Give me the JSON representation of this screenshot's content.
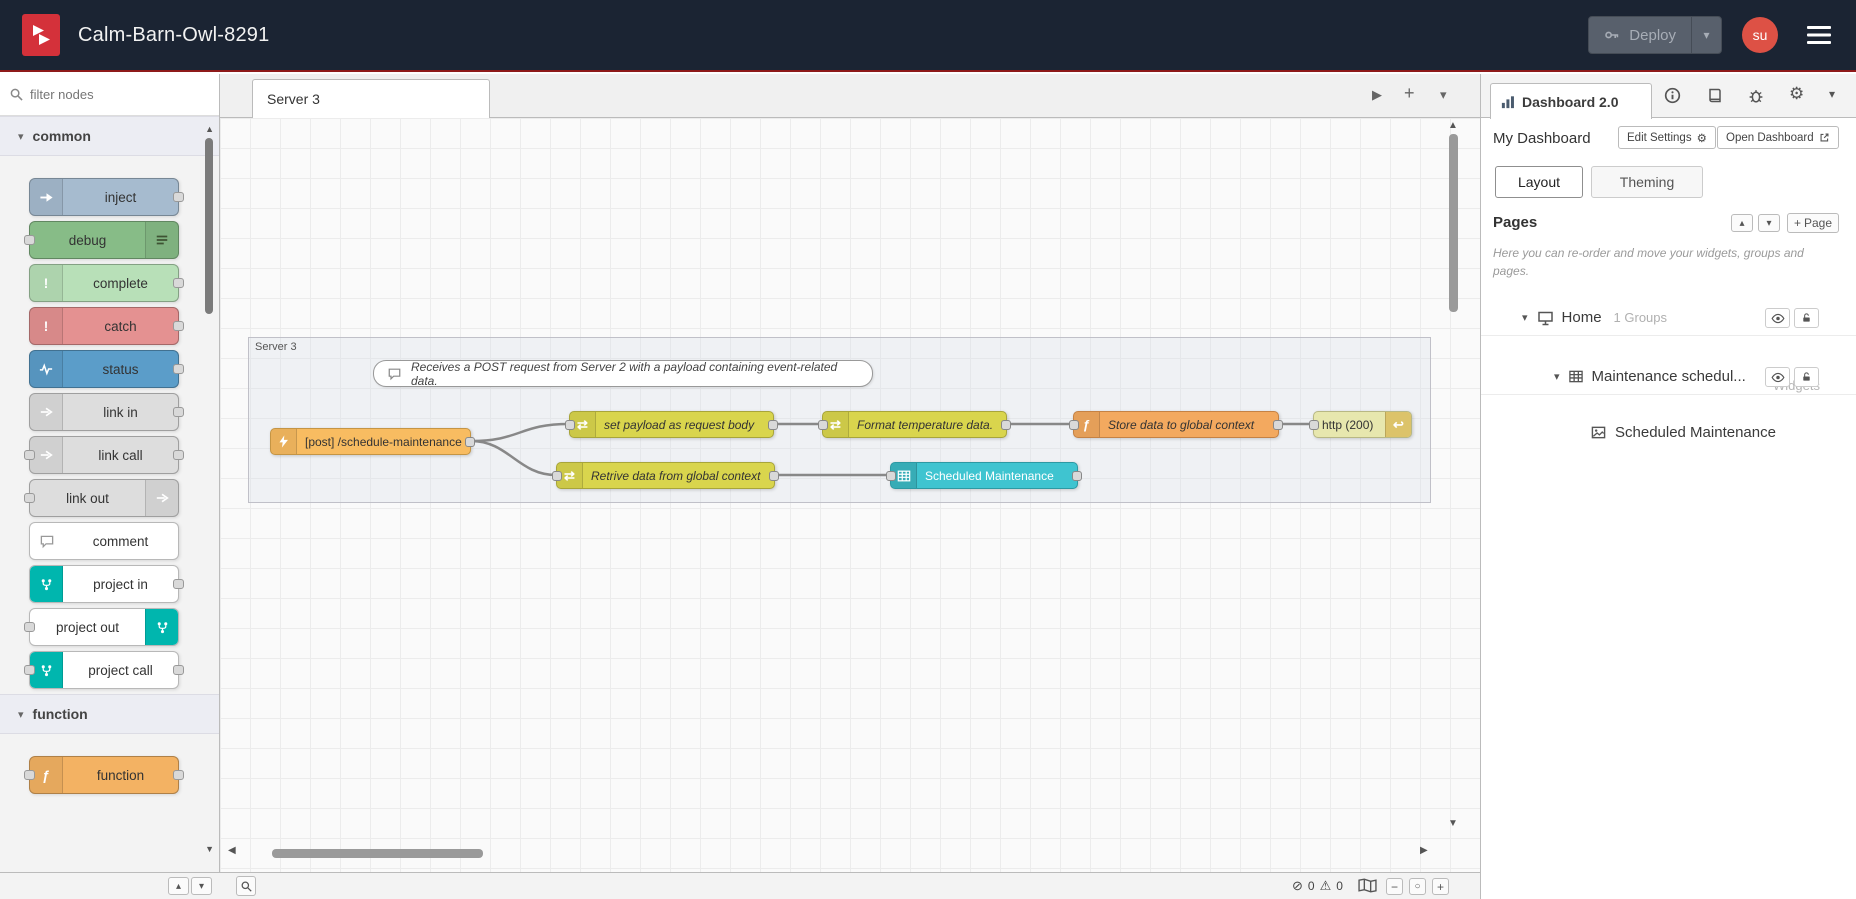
{
  "icons": {
    "chevron_down": "▾",
    "chevron_up": "▴",
    "triangle_right": "▶",
    "triangle_left": "◀",
    "triangle_up": "▲",
    "triangle_down": "▼",
    "plus": "+",
    "minus": "−",
    "circle": "○",
    "gear": "⚙",
    "warning": "⚠",
    "error": "⊘",
    "function_f": "ƒ",
    "shuffle": "⇄",
    "return_arrow": "↩",
    "exclamation": "!"
  },
  "header": {
    "title": "Calm-Barn-Owl-8291",
    "deploy": "Deploy",
    "user": "su"
  },
  "palette": {
    "filter_placeholder": "filter nodes",
    "categories": [
      {
        "label": "common",
        "items": [
          {
            "label": "inject",
            "color": "#a6bbcf"
          },
          {
            "label": "debug",
            "color": "#87bc87"
          },
          {
            "label": "complete",
            "color": "#b8e0b8"
          },
          {
            "label": "catch",
            "color": "#e49191"
          },
          {
            "label": "status",
            "color": "#5b9dc9"
          },
          {
            "label": "link in",
            "color": "#dddddd"
          },
          {
            "label": "link call",
            "color": "#dddddd"
          },
          {
            "label": "link out",
            "color": "#dddddd"
          },
          {
            "label": "comment",
            "color": "#ffffff"
          },
          {
            "label": "project in",
            "color": "#ffffff"
          },
          {
            "label": "project out",
            "color": "#ffffff"
          },
          {
            "label": "project call",
            "color": "#ffffff"
          }
        ]
      },
      {
        "label": "function",
        "items": [
          {
            "label": "function",
            "color": "#f3b263"
          }
        ]
      }
    ]
  },
  "workspace": {
    "tab": "Server 3",
    "group": "Server 3",
    "comment": "Receives a POST request from Server 2 with a payload containing event-related data.",
    "nodes": {
      "http_in": "[post] /schedule-maintenance",
      "set_payload": "set payload as request body",
      "format_temp": "Format temperature data.",
      "store_data": "Store data to global context",
      "http_response": "http (200)",
      "retrieve_data": "Retrive data from global context",
      "ui_table": "Scheduled Maintenance"
    },
    "status": {
      "errors": "0",
      "warnings": "0"
    }
  },
  "sidebar": {
    "tab": "Dashboard 2.0",
    "dashboard_name": "My Dashboard",
    "edit_settings": "Edit Settings",
    "open_dashboard": "Open Dashboard",
    "tab_layout": "Layout",
    "tab_theming": "Theming",
    "pages_title": "Pages",
    "page_button": "Page",
    "help_text": "Here you can re-order and move your widgets, groups and pages.",
    "tree": {
      "page_label": "Home",
      "page_count": "1 Groups",
      "group_label": "Maintenance schedul...",
      "group_count": "1 Widgets",
      "widget_label": "Scheduled Maintenance"
    }
  },
  "colors": {
    "header_bg": "#1b2433",
    "header_accent": "#8e1a1a",
    "node_http_in": "#f8bc61",
    "node_change": "#d9d54d",
    "node_function": "#f3a95f",
    "node_http_response": "#e7e7ae",
    "node_ui_table": "#3fc4d0",
    "project_teal": "#00b6ae",
    "avatar_red": "#dd5145"
  }
}
